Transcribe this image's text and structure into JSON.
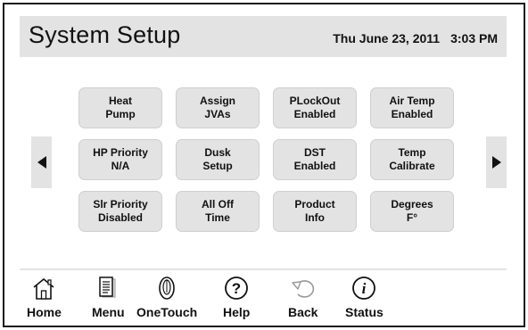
{
  "header": {
    "title": "System Setup",
    "date": "Thu June 23, 2011",
    "time": "3:03 PM"
  },
  "grid": {
    "buttons": [
      {
        "line1": "Heat",
        "line2": "Pump"
      },
      {
        "line1": "Assign",
        "line2": "JVAs"
      },
      {
        "line1": "PLockOut",
        "line2": "Enabled"
      },
      {
        "line1": "Air Temp",
        "line2": "Enabled"
      },
      {
        "line1": "HP Priority",
        "line2": "N/A"
      },
      {
        "line1": "Dusk",
        "line2": "Setup"
      },
      {
        "line1": "DST",
        "line2": "Enabled"
      },
      {
        "line1": "Temp",
        "line2": "Calibrate"
      },
      {
        "line1": "Slr Priority",
        "line2": "Disabled"
      },
      {
        "line1": "All Off",
        "line2": "Time"
      },
      {
        "line1": "Product",
        "line2": "Info"
      },
      {
        "line1": "Degrees",
        "line2": "F°"
      }
    ]
  },
  "nav": {
    "items": [
      {
        "label": "Home",
        "icon": "home-icon"
      },
      {
        "label": "Menu",
        "icon": "menu-icon"
      },
      {
        "label": "OneTouch",
        "icon": "onetouch-icon"
      },
      {
        "label": "Help",
        "icon": "help-icon"
      },
      {
        "label": "Back",
        "icon": "back-icon"
      },
      {
        "label": "Status",
        "icon": "status-icon"
      }
    ]
  },
  "icons": {
    "prev": "triangle-left-icon",
    "next": "triangle-right-icon",
    "help_glyph": "?",
    "status_glyph": "i"
  },
  "colors": {
    "panel": "#e3e3e3",
    "text": "#111111",
    "border": "#1a1a1a"
  }
}
